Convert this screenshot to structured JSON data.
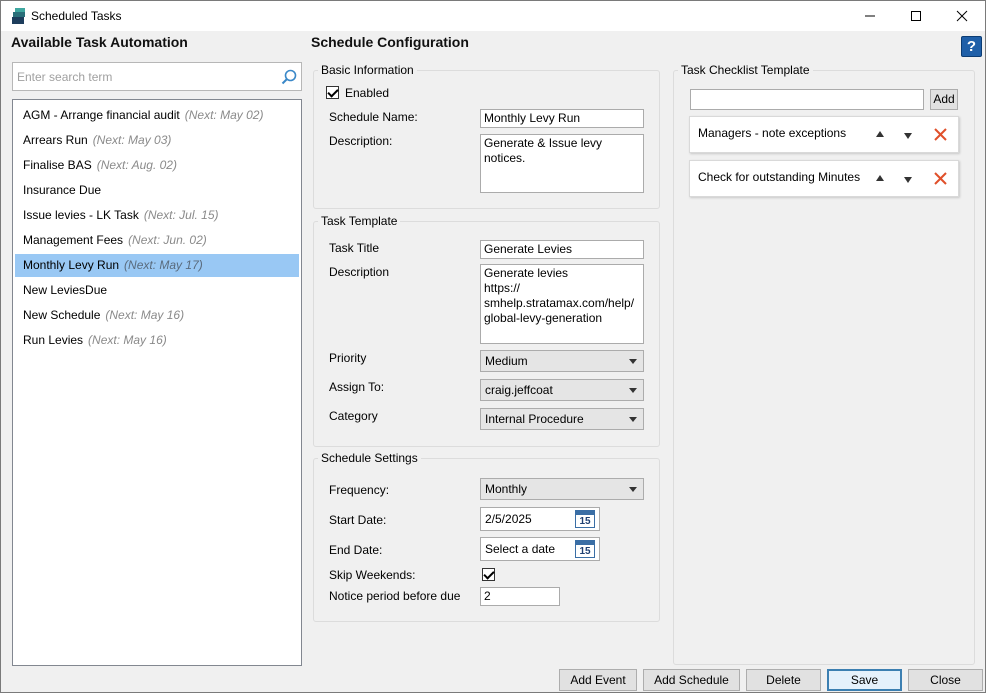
{
  "window": {
    "title": "Scheduled Tasks",
    "minimize": "—",
    "maximize": "☐",
    "close": "✕",
    "help": "?"
  },
  "left": {
    "heading": "Available Task Automation",
    "search_placeholder": "Enter search term",
    "items": [
      {
        "name": "AGM - Arrange financial audit",
        "next": "(Next: May 02)"
      },
      {
        "name": "Arrears Run",
        "next": "(Next: May 03)"
      },
      {
        "name": "Finalise BAS",
        "next": "(Next: Aug. 02)"
      },
      {
        "name": "Insurance Due",
        "next": ""
      },
      {
        "name": "Issue levies - LK Task",
        "next": "(Next: Jul. 15)"
      },
      {
        "name": "Management Fees",
        "next": "(Next: Jun. 02)"
      },
      {
        "name": "Monthly Levy Run",
        "next": "(Next: May 17)"
      },
      {
        "name": "New LeviesDue",
        "next": ""
      },
      {
        "name": "New Schedule",
        "next": "(Next: May 16)"
      },
      {
        "name": "Run Levies",
        "next": "(Next: May 16)"
      }
    ],
    "selected_index": 6
  },
  "config": {
    "heading": "Schedule Configuration",
    "basic": {
      "group_label": "Basic Information",
      "enabled_label": "Enabled",
      "enabled": true,
      "name_label": "Schedule Name:",
      "name_value": "Monthly Levy Run",
      "desc_label": "Description:",
      "desc_value": "Generate & Issue levy notices."
    },
    "template": {
      "group_label": "Task Template",
      "title_label": "Task Title",
      "title_value": "Generate Levies",
      "desc_label": "Description",
      "desc_value": "Generate levies\nhttps://\nsmhelp.stratamax.com/help/\nglobal-levy-generation",
      "priority_label": "Priority",
      "priority_value": "Medium",
      "assign_label": "Assign To:",
      "assign_value": "craig.jeffcoat",
      "category_label": "Category",
      "category_value": "Internal Procedure"
    },
    "settings": {
      "group_label": "Schedule Settings",
      "frequency_label": "Frequency:",
      "frequency_value": "Monthly",
      "start_label": "Start Date:",
      "start_value": "2/5/2025",
      "end_label": "End Date:",
      "end_placeholder": "Select a date",
      "calendar_day": "15",
      "skip_label": "Skip Weekends:",
      "skip_weekends": true,
      "notice_label": "Notice period before due",
      "notice_value": "2"
    }
  },
  "checklist": {
    "group_label": "Task Checklist Template",
    "add_label": "Add",
    "new_item_value": "",
    "items": [
      {
        "text": "Managers - note exceptions"
      },
      {
        "text": "Check for outstanding Minutes"
      }
    ]
  },
  "footer": {
    "add_event": "Add Event",
    "add_schedule": "Add Schedule",
    "delete": "Delete",
    "save": "Save",
    "close": "Close"
  },
  "colors": {
    "selection": "#99c8f4",
    "delete_icon": "#e0502a",
    "help_button": "#1f5fa8",
    "default_button_border": "#3c7fb1"
  }
}
